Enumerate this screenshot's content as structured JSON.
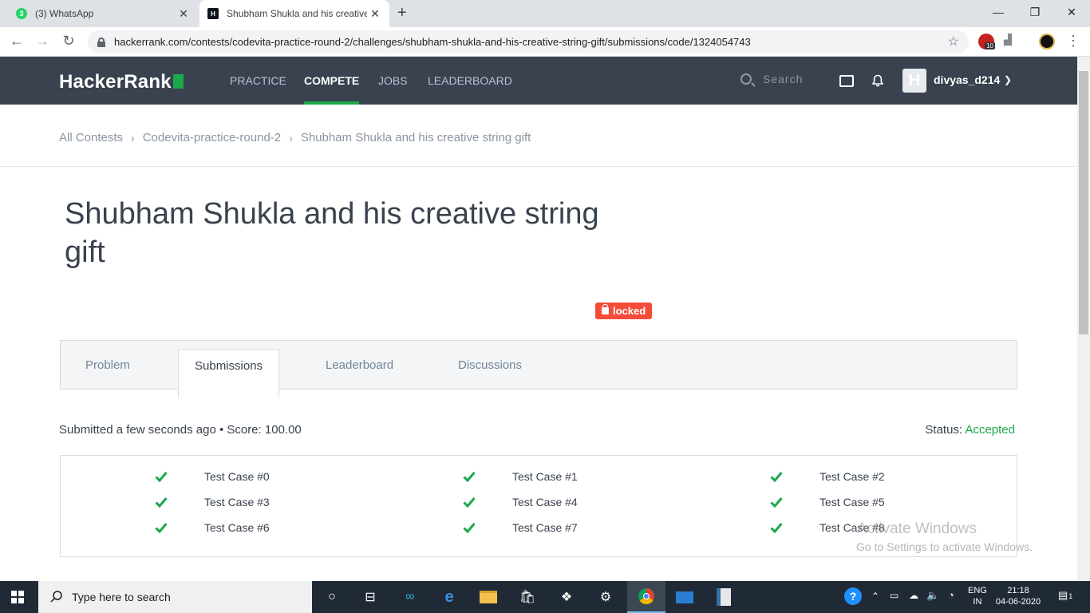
{
  "browser": {
    "tabs": [
      {
        "title": "(3) WhatsApp",
        "badge": "3"
      },
      {
        "title": "Shubham Shukla and his creative",
        "badge": "H"
      }
    ],
    "url": "hackerrank.com/contests/codevita-practice-round-2/challenges/shubham-shukla-and-his-creative-string-gift/submissions/code/1324054743",
    "ext_badge": "10"
  },
  "header": {
    "logo": "HackerRank",
    "nav": [
      "PRACTICE",
      "COMPETE",
      "JOBS",
      "LEADERBOARD"
    ],
    "active_nav": "COMPETE",
    "search_placeholder": "Search",
    "avatar_letter": "H",
    "username": "divyas_d214"
  },
  "breadcrumb": [
    "All Contests",
    "Codevita-practice-round-2",
    "Shubham Shukla and his creative string gift"
  ],
  "challenge": {
    "title": "Shubham Shukla and his creative string gift",
    "locked_label": "locked"
  },
  "content_tabs": [
    "Problem",
    "Submissions",
    "Leaderboard",
    "Discussions"
  ],
  "submission": {
    "info": "Submitted a few seconds ago • Score: 100.00",
    "status_label": "Status:",
    "status_value": "Accepted"
  },
  "test_cases": [
    "Test Case #0",
    "Test Case #1",
    "Test Case #2",
    "Test Case #3",
    "Test Case #4",
    "Test Case #5",
    "Test Case #6",
    "Test Case #7",
    "Test Case #8"
  ],
  "watermark": {
    "line1": "Activate Windows",
    "line2": "Go to Settings to activate Windows."
  },
  "taskbar": {
    "search_placeholder": "Type here to search",
    "lang": "ENG",
    "region": "IN",
    "time": "21:18",
    "date": "04-06-2020",
    "notif_count": "1"
  },
  "colors": {
    "nav_bg": "#39424e",
    "accent_green": "#1ba94c",
    "locked_red": "#f44c39"
  }
}
